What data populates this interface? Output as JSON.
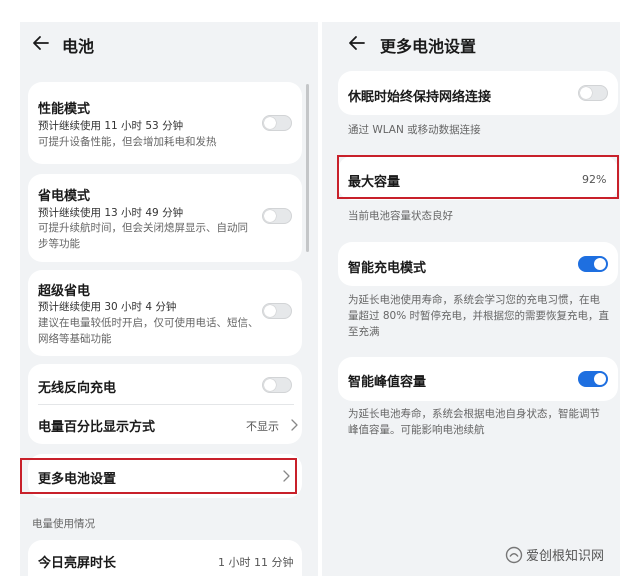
{
  "left": {
    "title": "电池",
    "performance": {
      "title": "性能模式",
      "estimate": "预计继续使用 11 小时 53 分钟",
      "desc": "可提升设备性能，但会增加耗电和发热"
    },
    "power_saving": {
      "title": "省电模式",
      "estimate": "预计继续使用 13 小时 49 分钟",
      "desc": "可提升续航时间，但会关闭熄屏显示、自动同步等功能"
    },
    "super_saving": {
      "title": "超级省电",
      "estimate": "预计继续使用 30 小时 4 分钟",
      "desc": "建议在电量较低时开启，仅可使用电话、短信、网络等基础功能"
    },
    "wireless_reverse": {
      "title": "无线反向充电"
    },
    "percent_display": {
      "title": "电量百分比显示方式",
      "value": "不显示"
    },
    "more_settings": {
      "title": "更多电池设置"
    },
    "usage_section": "电量使用情况",
    "screen_time": {
      "title": "今日亮屏时长",
      "value": "1 小时 11 分钟"
    }
  },
  "right": {
    "title": "更多电池设置",
    "stay_connected": {
      "title": "休眠时始终保持网络连接",
      "note": "通过 WLAN 或移动数据连接"
    },
    "max_capacity": {
      "title": "最大容量",
      "value": "92%",
      "note": "当前电池容量状态良好"
    },
    "smart_charging": {
      "title": "智能充电模式",
      "desc": "为延长电池使用寿命，系统会学习您的充电习惯，在电量超过 80% 时暂停充电，并根据您的需要恢复充电，直至充满"
    },
    "peak_capacity": {
      "title": "智能峰值容量",
      "desc": "为延长电池寿命，系统会根据电池自身状态，智能调节峰值容量。可能影响电池续航"
    }
  },
  "toggles": {
    "performance": false,
    "power_saving": false,
    "super_saving": false,
    "wireless_reverse": false,
    "stay_connected": false,
    "smart_charging": true,
    "peak_capacity": true
  },
  "icons": {
    "back": "arrow-left-icon",
    "chevron": "chevron-right-icon",
    "watermark": "watermark-logo-icon"
  },
  "colors": {
    "accent": "#1e6fe0",
    "highlight": "#c8202a",
    "background": "#f1f3f5"
  },
  "watermark": {
    "text": "爱创根知识网"
  }
}
